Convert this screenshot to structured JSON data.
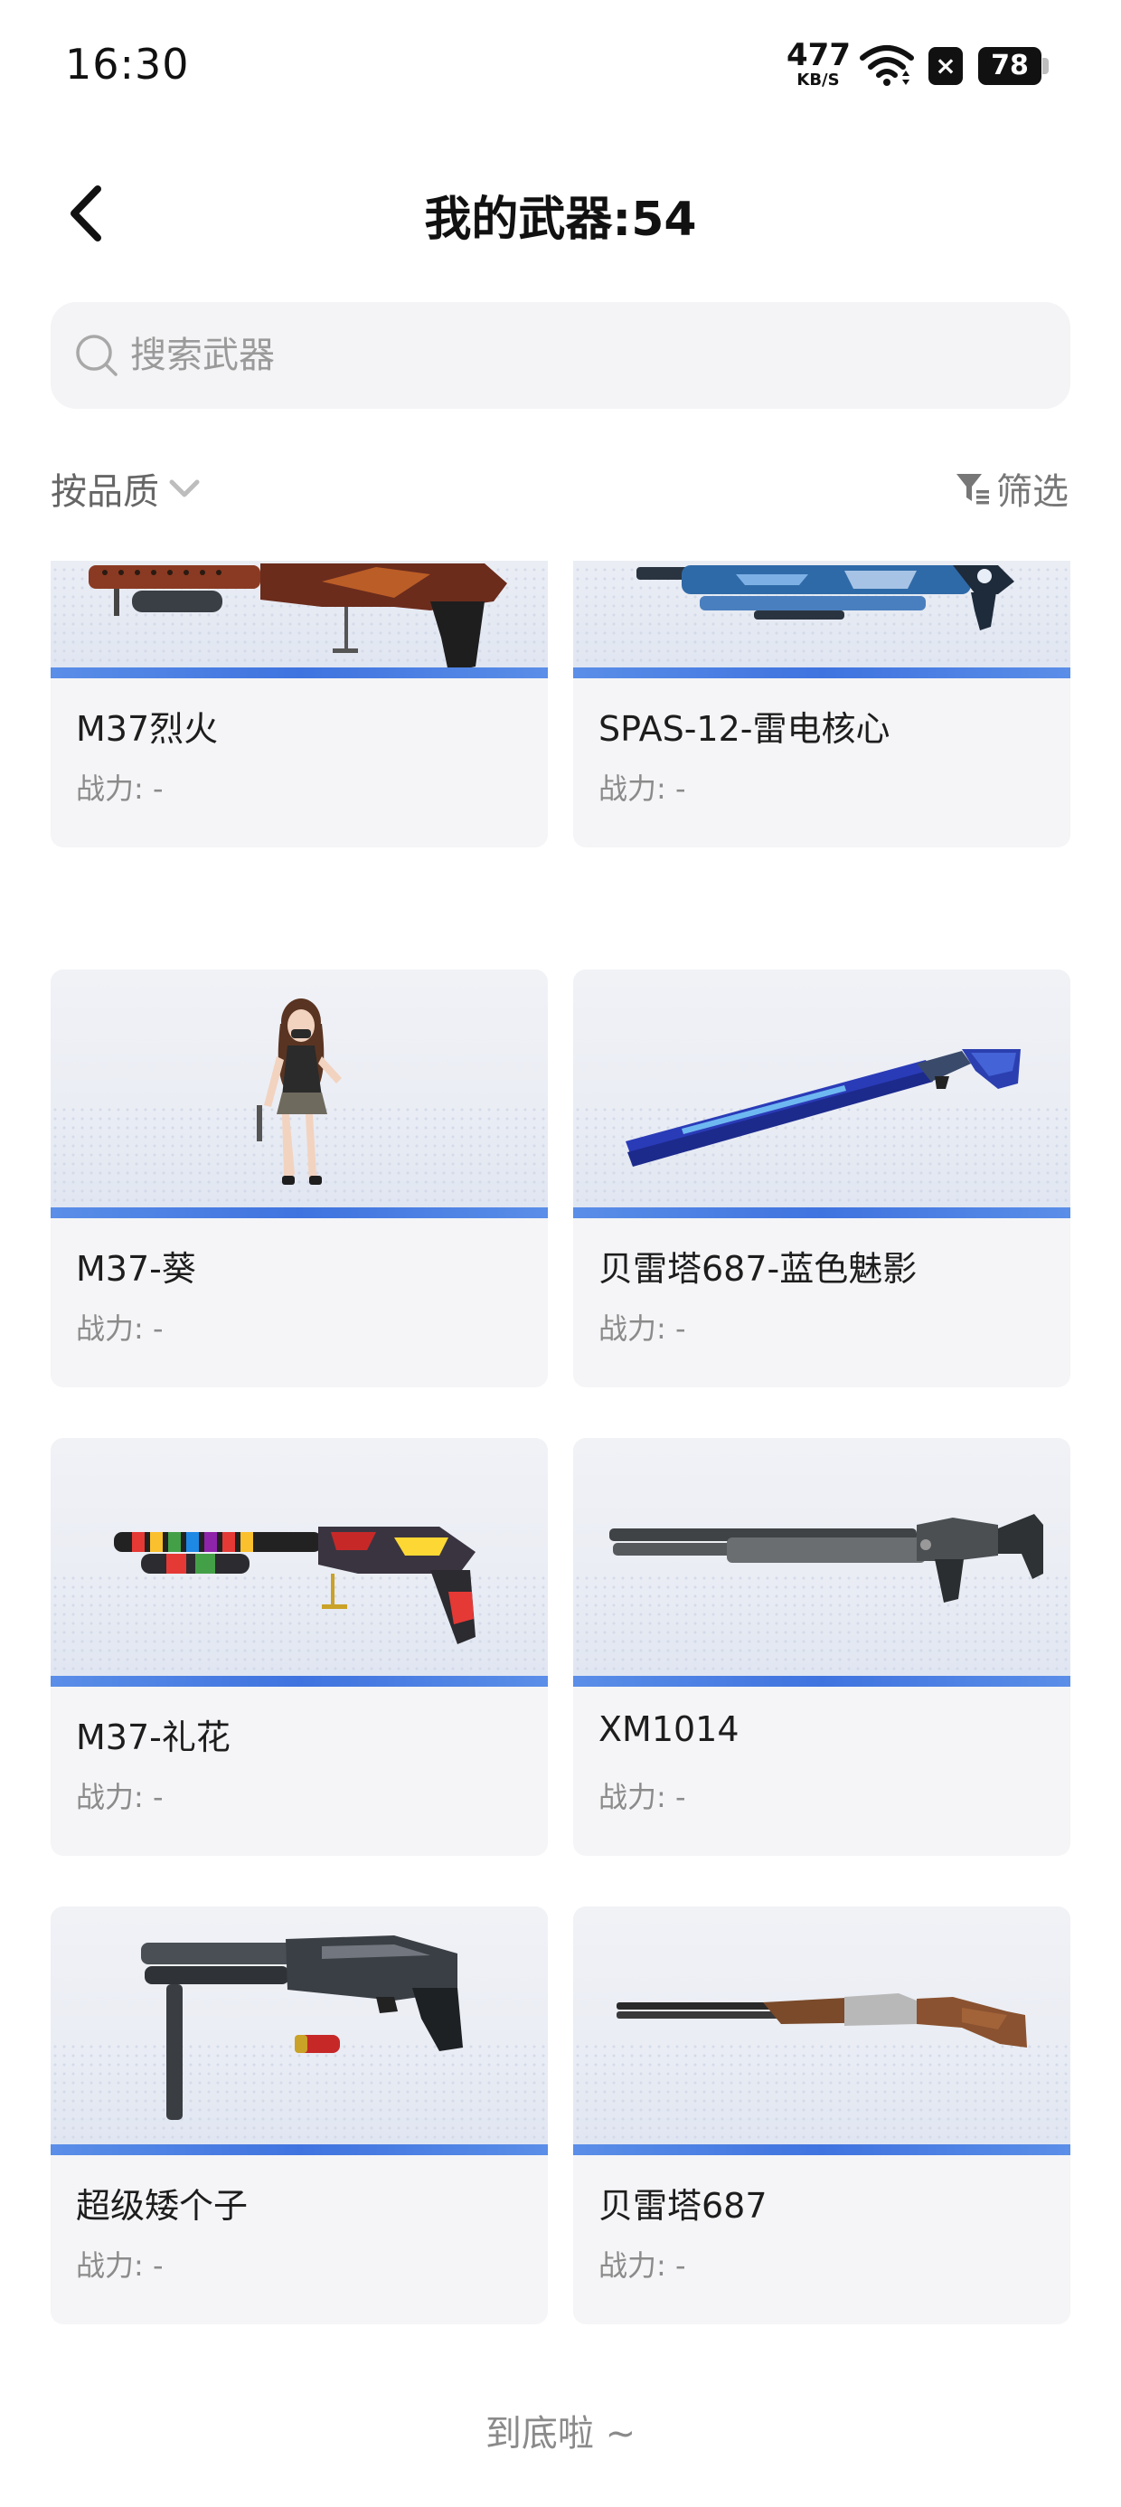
{
  "status_bar": {
    "time": "16:30",
    "net_speed": "477",
    "net_unit": "KB/S",
    "battery": "78",
    "icons": [
      "wifi-icon",
      "close-badge-icon",
      "battery-icon"
    ]
  },
  "header": {
    "title": "我的武器:54",
    "back_icon": "chevron-left-icon"
  },
  "search": {
    "placeholder": "搜索武器",
    "value": ""
  },
  "filters": {
    "sort_label": "按品质",
    "filter_label": "筛选"
  },
  "weapons": [
    {
      "name": "M37烈火",
      "power_label": "战力:",
      "power_value": "-"
    },
    {
      "name": "SPAS-12-雷电核心",
      "power_label": "战力:",
      "power_value": "-"
    },
    {
      "name": "M37-葵",
      "power_label": "战力:",
      "power_value": "-"
    },
    {
      "name": "贝雷塔687-蓝色魅影",
      "power_label": "战力:",
      "power_value": "-"
    },
    {
      "name": "M37-礼花",
      "power_label": "战力:",
      "power_value": "-"
    },
    {
      "name": "XM1014",
      "power_label": "战力:",
      "power_value": "-"
    },
    {
      "name": "超级矮个子",
      "power_label": "战力:",
      "power_value": "-"
    },
    {
      "name": "贝雷塔687",
      "power_label": "战力:",
      "power_value": "-"
    }
  ],
  "footer": {
    "end_text": "到底啦 ~"
  },
  "colors": {
    "accent_stripe": "#3f73df",
    "card_bg": "#f5f5f7",
    "search_bg": "#f4f4f6"
  }
}
